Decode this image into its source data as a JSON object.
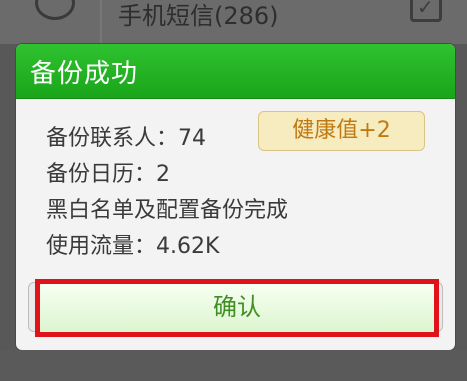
{
  "background": {
    "row_label": "手机短信(286)"
  },
  "dialog": {
    "title": "备份成功",
    "lines": [
      "备份联系人：74",
      "备份日历：2",
      "黑白名单及配置备份完成",
      "使用流量：4.62K"
    ],
    "badge": "健康值+2",
    "confirm_label": "确认"
  },
  "colors": {
    "header_green": "#1aa51a",
    "badge_text": "#c07a12",
    "highlight_red": "#e0131a"
  }
}
